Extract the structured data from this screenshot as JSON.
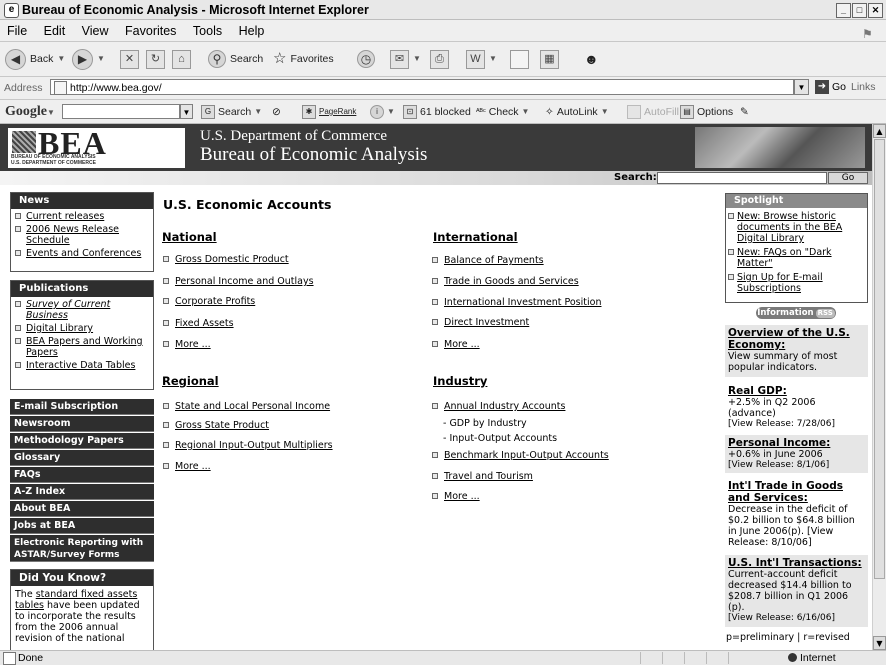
{
  "window": {
    "title": "Bureau of Economic Analysis - Microsoft Internet Explorer"
  },
  "menu": [
    "File",
    "Edit",
    "View",
    "Favorites",
    "Tools",
    "Help"
  ],
  "toolbar": {
    "back": "Back",
    "search": "Search",
    "favorites": "Favorites"
  },
  "address": {
    "label": "Address",
    "url": "http://www.bea.gov/",
    "go": "Go",
    "links": "Links"
  },
  "google": {
    "logo": "Google",
    "search": "Search",
    "pagerank": "PageRank",
    "blocked": "61 blocked",
    "check": "Check",
    "autolink": "AutoLink",
    "autofill": "AutoFill",
    "options": "Options"
  },
  "header": {
    "logo": "BEA",
    "logo_sub1": "BUREAU OF ECONOMIC ANALYSIS",
    "logo_sub2": "U.S. DEPARTMENT OF COMMERCE",
    "dept": "U.S. Department of Commerce",
    "bureau": "Bureau of Economic Analysis",
    "search_label": "Search:",
    "go": "Go"
  },
  "news": {
    "title": "News",
    "items": [
      "Current releases",
      "2006 News Release Schedule",
      "Events and Conferences"
    ]
  },
  "publications": {
    "title": "Publications",
    "items": [
      "Survey of Current Business",
      "Digital Library",
      "BEA Papers and Working Papers",
      "Interactive Data Tables"
    ]
  },
  "darknav": [
    "E-mail Subscription Service",
    "Newsroom",
    "Methodology Papers",
    "Glossary",
    "FAQs",
    "A-Z Index",
    "About BEA",
    "Jobs at BEA",
    "Electronic Reporting with ASTAR/Survey Forms"
  ],
  "didyouknow": {
    "title": "Did You Know?",
    "pre": "The ",
    "link": "standard fixed assets tables",
    "post": " have been updated to incorporate the results from the 2006 annual revision of the national"
  },
  "main": {
    "title": "U.S. Economic Accounts",
    "national": {
      "title": "National",
      "items": [
        "Gross Domestic Product",
        "Personal Income and Outlays",
        "Corporate Profits",
        "Fixed Assets",
        "More ..."
      ]
    },
    "international": {
      "title": "International",
      "items": [
        "Balance of Payments",
        "Trade in Goods and Services",
        "International Investment Position",
        "Direct Investment",
        "More ..."
      ]
    },
    "regional": {
      "title": "Regional",
      "items": [
        "State and Local Personal Income",
        "Gross State Product",
        "Regional Input-Output Multipliers",
        "More ..."
      ]
    },
    "industry": {
      "title": "Industry",
      "item1": "Annual Industry Accounts",
      "sub1": "- GDP by Industry",
      "sub2": "- Input-Output Accounts",
      "item2": "Benchmark Input-Output Accounts",
      "item3": "Travel and Tourism",
      "item4": "More ..."
    }
  },
  "spotlight": {
    "title": "Spotlight",
    "items": [
      "New: Browse historic documents in the BEA Digital Library",
      "New: FAQs on \"Dark Matter\"",
      "Sign Up for E-mail Subscriptions"
    ]
  },
  "info": {
    "label": "Information",
    "rss": "RSS"
  },
  "indicators": [
    {
      "title": "Overview of the U.S. Economy:",
      "body": "View summary of most popular indicators.",
      "release": ""
    },
    {
      "title": "Real GDP:",
      "body": "+2.5% in Q2 2006 (advance)",
      "release": "[View Release: 7/28/06]"
    },
    {
      "title": "Personal Income:",
      "body": "+0.6% in June 2006",
      "release": "[View Release: 8/1/06]"
    },
    {
      "title": "Int'l Trade in Goods and Services:",
      "body": "Decrease in the deficit of $0.2 billion to $64.8 billion in June 2006(p). [View Release: 8/10/06]",
      "release": ""
    },
    {
      "title": "U.S. Int'l Transactions:",
      "body": "Current-account deficit decreased $14.4 billion to $208.7 billion in Q1 2006 (p).",
      "release": "[View Release: 6/16/06]"
    }
  ],
  "legend": "p=preliminary | r=revised",
  "status": {
    "text": "Done",
    "zone": "Internet"
  }
}
